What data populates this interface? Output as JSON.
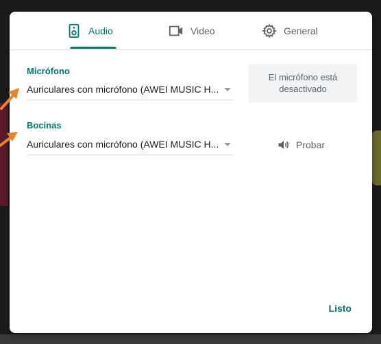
{
  "tabs": [
    {
      "label": "Audio",
      "icon": "speaker-icon",
      "active": true
    },
    {
      "label": "Video",
      "icon": "video-camera-icon",
      "active": false
    },
    {
      "label": "General",
      "icon": "gear-icon",
      "active": false
    }
  ],
  "microphone": {
    "label": "Micrófono",
    "selected": "Auriculares con micrófono (AWEI MUSIC H...",
    "status": "El micrófono está desactivado"
  },
  "speakers": {
    "label": "Bocinas",
    "selected": "Auriculares con micrófono (AWEI MUSIC H...",
    "test_label": "Probar"
  },
  "done_label": "Listo",
  "colors": {
    "accent": "#00796b",
    "annotation_arrow": "#e8822f"
  }
}
